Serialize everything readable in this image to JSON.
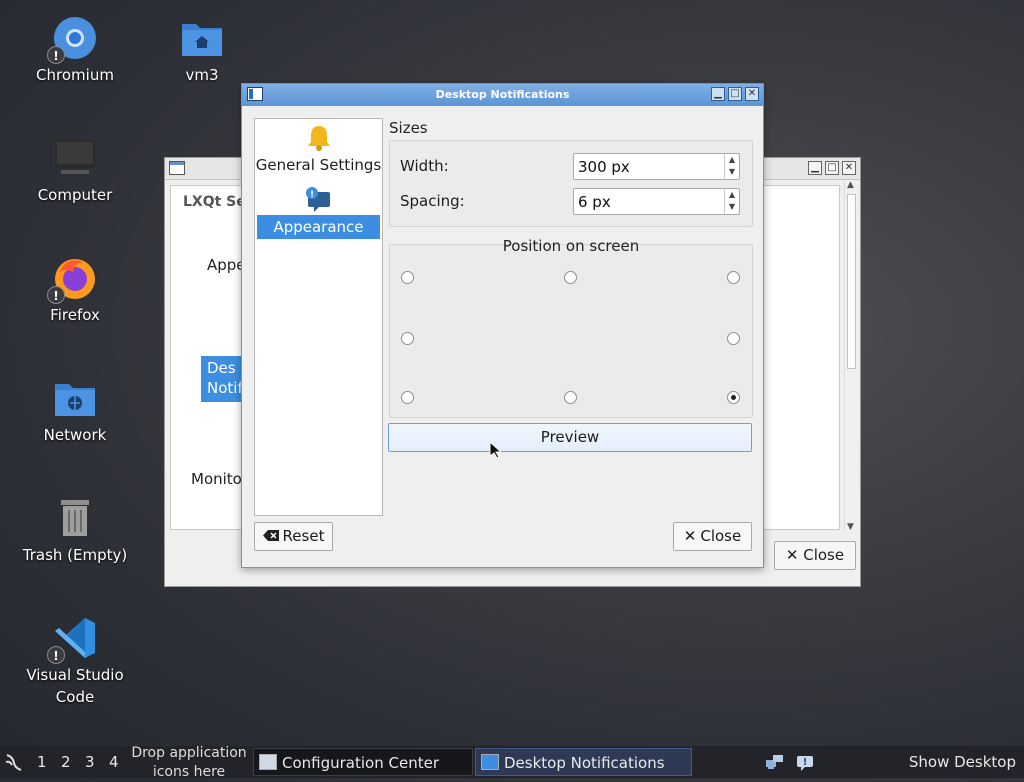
{
  "desktop": {
    "icons": [
      {
        "label": "Chromium",
        "icon": "chromium-icon"
      },
      {
        "label": "vm3",
        "icon": "home-folder-icon"
      },
      {
        "label": "Computer",
        "icon": "computer-icon"
      },
      {
        "label": "Firefox",
        "icon": "firefox-icon"
      },
      {
        "label": "Network",
        "icon": "network-folder-icon"
      },
      {
        "label": "Trash (Empty)",
        "icon": "trash-icon"
      },
      {
        "label": "Visual Studio Code",
        "icon": "vscode-icon"
      }
    ]
  },
  "bg_window": {
    "search_text": "LXQt Set",
    "items": [
      "Appe",
      "Des Notif",
      "Monito"
    ],
    "close_label": "Close"
  },
  "dialog": {
    "title": "Desktop Notifications",
    "nav": [
      {
        "label": "General Settings",
        "icon": "bell-icon"
      },
      {
        "label": "Appearance",
        "icon": "notification-bubble-icon"
      }
    ],
    "sizes": {
      "title": "Sizes",
      "width_label": "Width:",
      "width_value": "300 px",
      "spacing_label": "Spacing:",
      "spacing_value": "6 px"
    },
    "position": {
      "title": "Position on screen",
      "selected": "bottom-right"
    },
    "preview_label": "Preview",
    "reset_label": "Reset",
    "close_label": "Close"
  },
  "taskbar": {
    "workspaces": [
      "1",
      "2",
      "3",
      "4"
    ],
    "drop_hint": "Drop application icons here",
    "tasks": [
      {
        "label": "Configuration Center",
        "active": false
      },
      {
        "label": "Desktop Notifications",
        "active": true
      }
    ],
    "show_desktop": "Show Desktop"
  },
  "colors": {
    "accent": "#3d8ee0",
    "titlebar": "#5b93d4",
    "taskbar": "#232429"
  }
}
